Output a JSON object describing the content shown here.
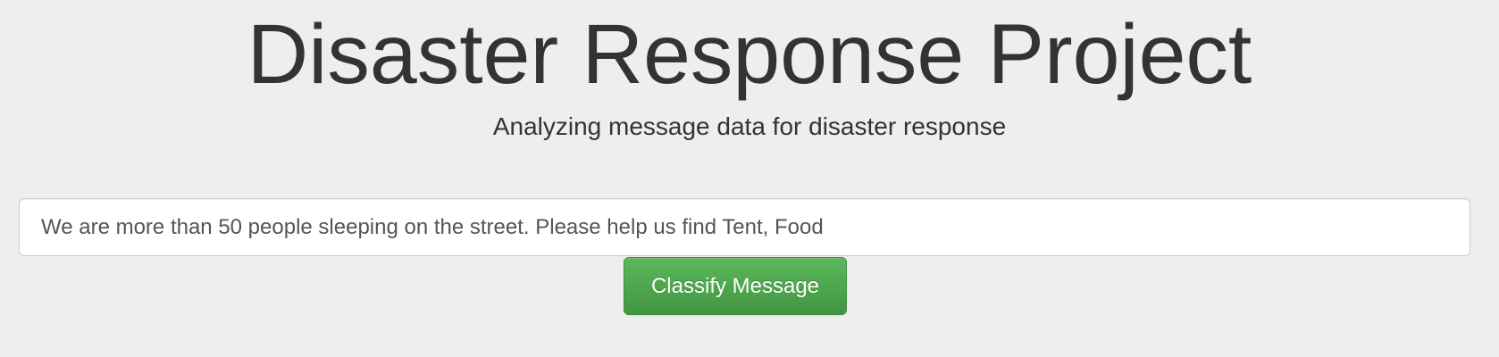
{
  "header": {
    "title": "Disaster Response Project",
    "subtitle": "Analyzing message data for disaster response"
  },
  "form": {
    "message_value": "We are more than 50 people sleeping on the street. Please help us find Tent, Food",
    "classify_label": "Classify Message"
  },
  "colors": {
    "background": "#eeeeee",
    "text": "#333333",
    "button_green": "#5cb85c"
  }
}
